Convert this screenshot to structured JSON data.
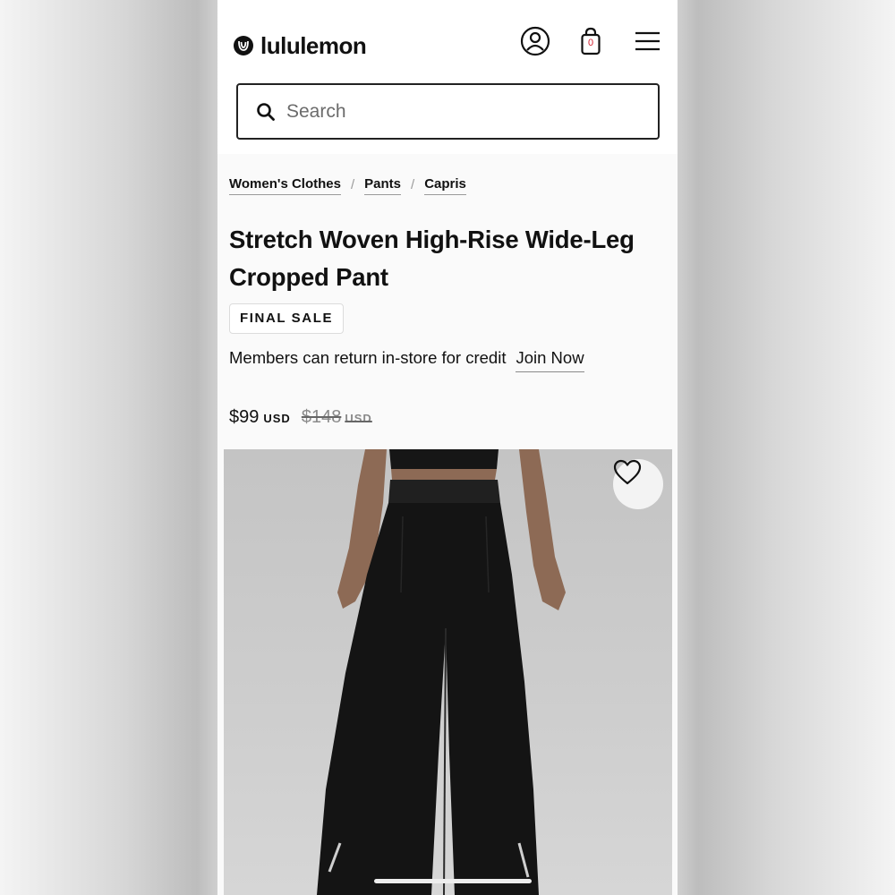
{
  "header": {
    "brand": "lululemon",
    "bag_count": "0"
  },
  "search": {
    "placeholder": "Search"
  },
  "breadcrumb": [
    {
      "label": "Women's Clothes"
    },
    {
      "label": "Pants"
    },
    {
      "label": "Capris"
    }
  ],
  "product": {
    "title": "Stretch Woven High-Rise Wide-Leg Cropped Pant",
    "badge": "FINAL SALE",
    "return_text": "Members can return in-store for credit",
    "join_link": "Join Now",
    "price_now": "$99",
    "price_now_currency": "USD",
    "price_was": "$148",
    "price_was_currency": "USD"
  },
  "icons": {
    "logo": "lululemon-logo-icon",
    "account": "account-icon",
    "bag": "shopping-bag-icon",
    "menu": "hamburger-menu-icon",
    "search": "search-icon",
    "wishlist": "heart-icon"
  },
  "colors": {
    "text": "#111111",
    "bag_count": "#d22030",
    "image_background": "#c8c8c8"
  }
}
